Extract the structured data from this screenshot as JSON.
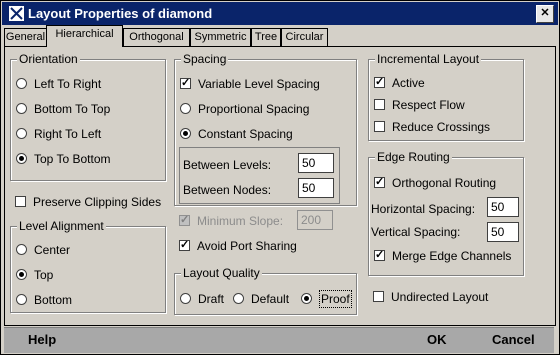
{
  "window": {
    "title": "Layout Properties of diamond",
    "close_symbol": "✕"
  },
  "tabs": [
    "General",
    "Hierarchical",
    "Orthogonal",
    "Symmetric",
    "Tree",
    "Circular"
  ],
  "active_tab": "Hierarchical",
  "orientation": {
    "title": "Orientation",
    "options": [
      "Left To Right",
      "Bottom To Top",
      "Right To Left",
      "Top To Bottom"
    ],
    "selected": "Top To Bottom"
  },
  "preserve_clipping": {
    "label": "Preserve Clipping Sides",
    "checked": false
  },
  "level_alignment": {
    "title": "Level Alignment",
    "options": [
      "Center",
      "Top",
      "Bottom"
    ],
    "selected": "Top"
  },
  "spacing": {
    "title": "Spacing",
    "variable": {
      "label": "Variable Level Spacing",
      "checked": true
    },
    "proportional": {
      "label": "Proportional Spacing",
      "selected": false
    },
    "constant": {
      "label": "Constant Spacing",
      "selected": true
    },
    "between_levels": {
      "label": "Between Levels:",
      "value": "50"
    },
    "between_nodes": {
      "label": "Between Nodes:",
      "value": "50"
    }
  },
  "minimum_slope": {
    "label": "Minimum Slope:",
    "value": "200",
    "checked": true,
    "disabled": true
  },
  "avoid_port_sharing": {
    "label": "Avoid Port Sharing",
    "checked": true
  },
  "layout_quality": {
    "title": "Layout Quality",
    "options": [
      "Draft",
      "Default",
      "Proof"
    ],
    "selected": "Proof"
  },
  "incremental": {
    "title": "Incremental Layout",
    "active": {
      "label": "Active",
      "checked": true
    },
    "respect_flow": {
      "label": "Respect Flow",
      "checked": false
    },
    "reduce_crossings": {
      "label": "Reduce Crossings",
      "checked": false
    }
  },
  "edge_routing": {
    "title": "Edge Routing",
    "orthogonal": {
      "label": "Orthogonal Routing",
      "checked": true
    },
    "horizontal_spacing": {
      "label": "Horizontal Spacing:",
      "value": "50"
    },
    "vertical_spacing": {
      "label": "Vertical Spacing:",
      "value": "50"
    },
    "merge_channels": {
      "label": "Merge Edge Channels",
      "checked": true
    }
  },
  "undirected": {
    "label": "Undirected Layout",
    "checked": false
  },
  "buttons": {
    "help": "Help",
    "ok": "OK",
    "cancel": "Cancel"
  },
  "colors": {
    "titlebar": "#0a246a",
    "panel": "#d4d0c8",
    "bottombar": "#a8a8a8"
  }
}
